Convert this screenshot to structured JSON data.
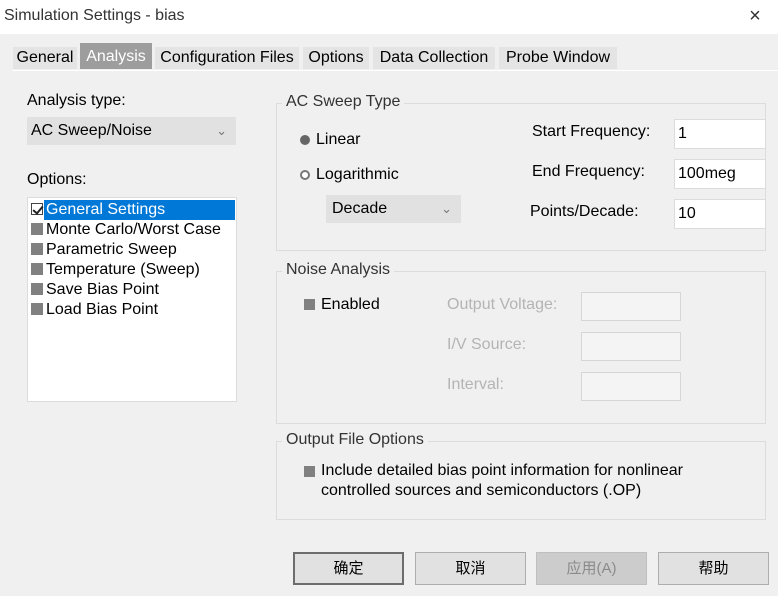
{
  "window": {
    "title": "Simulation Settings - bias",
    "close_label": "×"
  },
  "tabs": [
    "General",
    "Analysis",
    "Configuration Files",
    "Options",
    "Data Collection",
    "Probe Window"
  ],
  "analysis_type": {
    "label": "Analysis type:",
    "value": "AC Sweep/Noise"
  },
  "options": {
    "label": "Options:",
    "items": [
      "General Settings",
      "Monte Carlo/Worst Case",
      "Parametric Sweep",
      "Temperature (Sweep)",
      "Save Bias Point",
      "Load Bias Point"
    ]
  },
  "ac_sweep": {
    "title": "AC Sweep Type",
    "linear_label": "Linear",
    "log_label": "Logarithmic",
    "log_unit": "Decade",
    "start_label": "Start Frequency:",
    "start_value": "1",
    "end_label": "End Frequency:",
    "end_value": "100meg",
    "points_label": "Points/Decade:",
    "points_value": "10"
  },
  "noise": {
    "title": "Noise Analysis",
    "enabled_label": "Enabled",
    "output_voltage_label": "Output Voltage:",
    "iv_source_label": "I/V Source:",
    "interval_label": "Interval:"
  },
  "output_file": {
    "title": "Output File Options",
    "line1": "Include detailed bias point information for nonlinear",
    "line2": "controlled sources and semiconductors (.OP)"
  },
  "buttons": {
    "ok": "确定",
    "cancel": "取消",
    "apply": "应用(A)",
    "help": "帮助"
  },
  "colors": {
    "selection": "#0078d7",
    "active_tab": "#9d9d9d"
  }
}
